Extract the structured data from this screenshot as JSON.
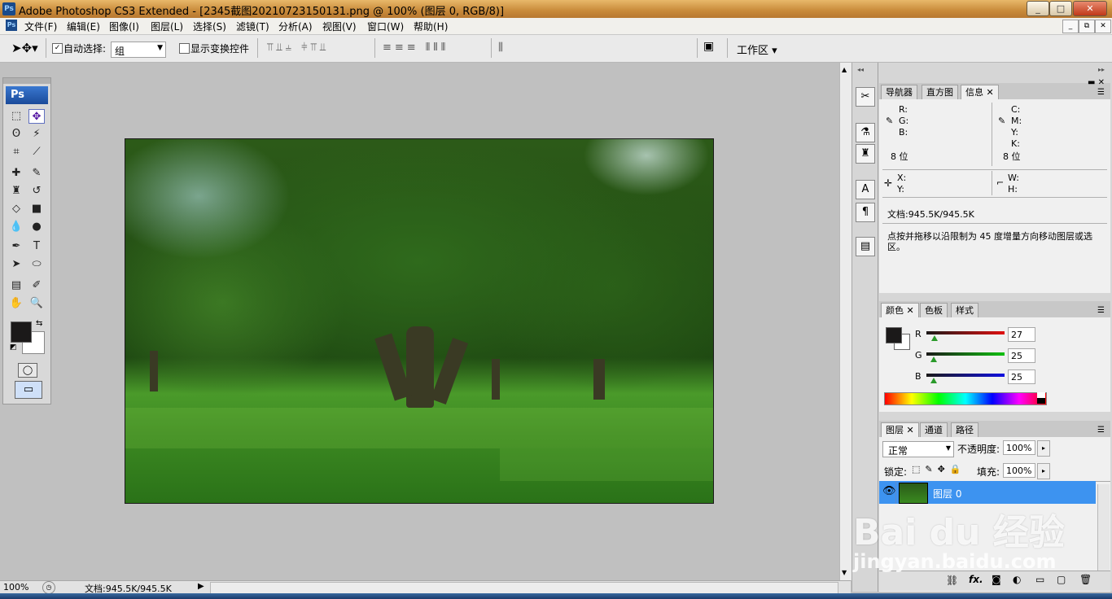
{
  "window": {
    "app_icon_text": "Ps",
    "title": "Adobe Photoshop CS3 Extended - [2345截图20210723150131.png @ 100% (图层 0, RGB/8)]",
    "controls": [
      "_",
      "□",
      "✕"
    ]
  },
  "menubar": {
    "items": [
      "文件(F)",
      "编辑(E)",
      "图像(I)",
      "图层(L)",
      "选择(S)",
      "滤镜(T)",
      "分析(A)",
      "视图(V)",
      "窗口(W)",
      "帮助(H)"
    ],
    "doc_controls": [
      "_",
      "⧉",
      "✕"
    ]
  },
  "options": {
    "auto_select_label": "自动选择:",
    "auto_select_checked": true,
    "auto_select_value": "组",
    "show_transform_label": "显示变换控件",
    "workspace_label": "工作区"
  },
  "toolbox": {
    "header": "Ps",
    "tools": [
      {
        "name": "rectangular-marquee-icon",
        "glyph": "⬚"
      },
      {
        "name": "move-icon",
        "glyph": "✥"
      },
      {
        "name": "lasso-icon",
        "glyph": "ʘ"
      },
      {
        "name": "magic-wand-icon",
        "glyph": "⚡"
      },
      {
        "name": "crop-icon",
        "glyph": "⌗"
      },
      {
        "name": "slice-icon",
        "glyph": "⟋"
      },
      {
        "name": "healing-brush-icon",
        "glyph": "✚"
      },
      {
        "name": "brush-icon",
        "glyph": "✎"
      },
      {
        "name": "clone-stamp-icon",
        "glyph": "♜"
      },
      {
        "name": "history-brush-icon",
        "glyph": "↺"
      },
      {
        "name": "eraser-icon",
        "glyph": "◇"
      },
      {
        "name": "gradient-icon",
        "glyph": "■"
      },
      {
        "name": "blur-icon",
        "glyph": "💧"
      },
      {
        "name": "dodge-icon",
        "glyph": "●"
      },
      {
        "name": "pen-icon",
        "glyph": "✒"
      },
      {
        "name": "type-icon",
        "glyph": "T"
      },
      {
        "name": "path-selection-icon",
        "glyph": "➤"
      },
      {
        "name": "ellipse-icon",
        "glyph": "⬭"
      },
      {
        "name": "notes-icon",
        "glyph": "▤"
      },
      {
        "name": "eyedropper-icon",
        "glyph": "✐"
      },
      {
        "name": "hand-icon",
        "glyph": "✋"
      },
      {
        "name": "zoom-icon",
        "glyph": "🔍"
      }
    ]
  },
  "status": {
    "zoom": "100%",
    "doc_info": "文档:945.5K/945.5K"
  },
  "info_panel": {
    "tabs": [
      "导航器",
      "直方图",
      "信息"
    ],
    "active_tab": "信息",
    "rgb_labels": [
      "R:",
      "G:",
      "B:"
    ],
    "cmyk_labels": [
      "C:",
      "M:",
      "Y:",
      "K:"
    ],
    "bits_left": "8 位",
    "bits_right": "8 位",
    "xy_labels": [
      "X:",
      "Y:"
    ],
    "wh_labels": [
      "W:",
      "H:"
    ],
    "doc_size": "文档:945.5K/945.5K",
    "hint": "点按并拖移以沿限制为 45 度增量方向移动图层或选区。"
  },
  "color_panel": {
    "tabs": [
      "颜色",
      "色板",
      "样式"
    ],
    "active_tab": "颜色",
    "channels": [
      {
        "label": "R",
        "value": "27",
        "fraction": 0.106,
        "color": "#e01010"
      },
      {
        "label": "G",
        "value": "25",
        "fraction": 0.098,
        "color": "#10c010"
      },
      {
        "label": "B",
        "value": "25",
        "fraction": 0.098,
        "color": "#1010e0"
      }
    ],
    "foreground": "#1b1919",
    "background": "#ffffff"
  },
  "layers_panel": {
    "tabs": [
      "图层",
      "通道",
      "路径"
    ],
    "active_tab": "图层",
    "blend_mode": "正常",
    "opacity_label": "不透明度:",
    "opacity_value": "100%",
    "lock_label": "锁定:",
    "fill_label": "填充:",
    "fill_value": "100%",
    "layers": [
      {
        "name": "图层 0",
        "visible": true,
        "selected": true
      }
    ],
    "footer_icons": [
      "link-icon",
      "fx-icon",
      "mask-icon",
      "adjustment-icon",
      "group-icon",
      "new-layer-icon",
      "trash-icon"
    ],
    "fx_label": "fx."
  },
  "watermark": {
    "logo": "Bai  du 经验",
    "url": "jingyan.baidu.com"
  }
}
